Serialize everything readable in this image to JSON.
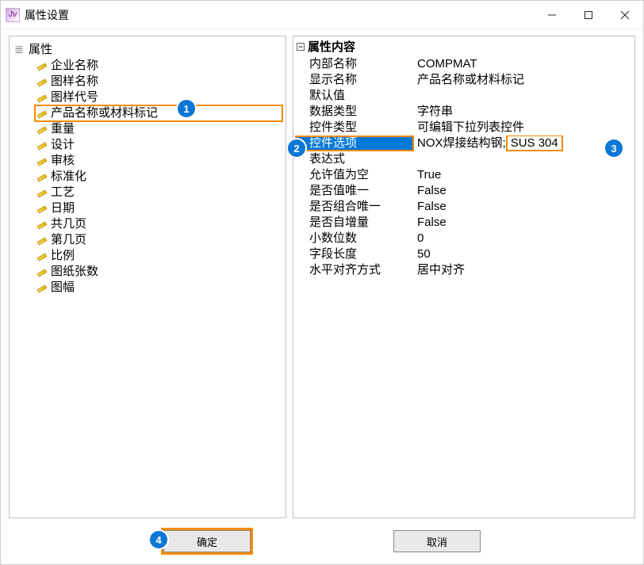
{
  "window": {
    "title": "属性设置"
  },
  "tree": {
    "root_label": "属性",
    "items": [
      "企业名称",
      "图样名称",
      "图样代号",
      "产品名称或材料标记",
      "重量",
      "设计",
      "审核",
      "标准化",
      "工艺",
      "日期",
      "共几页",
      "第几页",
      "比例",
      "图纸张数",
      "图幅"
    ],
    "highlighted_index": 3
  },
  "propgrid": {
    "header": "属性内容",
    "selected_key": "控件选项",
    "selected_value_prefix": "NOX焊接结构钢;",
    "selected_value_boxed": "SUS 304",
    "rows": [
      {
        "key": "内部名称",
        "value": "COMPMAT"
      },
      {
        "key": "显示名称",
        "value": "产品名称或材料标记"
      },
      {
        "key": "默认值",
        "value": ""
      },
      {
        "key": "数据类型",
        "value": "字符串"
      },
      {
        "key": "控件类型",
        "value": "可编辑下拉列表控件"
      },
      {
        "key": "控件选项",
        "value": "NOX焊接结构钢;SUS 304"
      },
      {
        "key": "表达式",
        "value": ""
      },
      {
        "key": "允许值为空",
        "value": "True"
      },
      {
        "key": "是否值唯一",
        "value": "False"
      },
      {
        "key": "是否组合唯一",
        "value": "False"
      },
      {
        "key": "是否自增量",
        "value": "False"
      },
      {
        "key": "小数位数",
        "value": "0"
      },
      {
        "key": "字段长度",
        "value": "50"
      },
      {
        "key": "水平对齐方式",
        "value": "居中对齐"
      }
    ]
  },
  "footer": {
    "ok_label": "确定",
    "cancel_label": "取消"
  },
  "callouts": {
    "c1": "1",
    "c2": "2",
    "c3": "3",
    "c4": "4"
  }
}
